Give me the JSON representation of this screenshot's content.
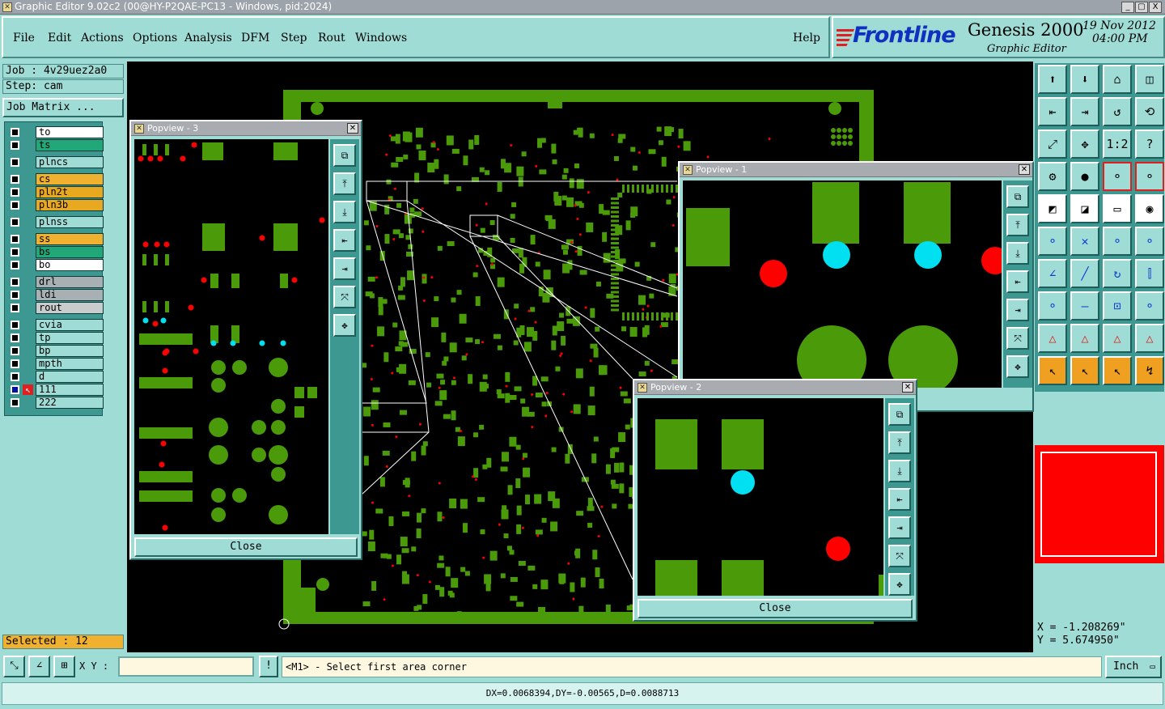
{
  "window": {
    "title": "Graphic Editor 9.02c2 (00@HY-P2QAE-PC13 - Windows, pid:2024)",
    "buttons": [
      "_",
      "▢",
      "X"
    ]
  },
  "menu": {
    "items": [
      "File",
      "Edit",
      "Actions",
      "Options",
      "Analysis",
      "DFM",
      "Step",
      "Rout",
      "Windows"
    ],
    "help": "Help"
  },
  "brand": {
    "logo": "Frontline",
    "product": "Genesis 2000",
    "subtitle": "Graphic Editor",
    "date": "19 Nov 2012",
    "time": "04:00 PM"
  },
  "job": {
    "job_label": "Job : 4v29uez2a0",
    "step_label": "Step: cam",
    "matrix_button": "Job Matrix ..."
  },
  "layers": [
    {
      "name": "to",
      "color": "#ffffff"
    },
    {
      "name": "ts",
      "color": "#22a878"
    },
    {
      "name": "plncs",
      "color": "#9fdcd6"
    },
    {
      "name": "cs",
      "color": "#f0b030"
    },
    {
      "name": "pln2t",
      "color": "#e8a820"
    },
    {
      "name": "pln3b",
      "color": "#e8a820"
    },
    {
      "name": "plnss",
      "color": "#9fdcd6"
    },
    {
      "name": "ss",
      "color": "#f0b030"
    },
    {
      "name": "bs",
      "color": "#22a878"
    },
    {
      "name": "bo",
      "color": "#ffffff"
    },
    {
      "name": "drl",
      "color": "#a8b0b4"
    },
    {
      "name": "ldi",
      "color": "#a8b0b4"
    },
    {
      "name": "rout",
      "color": "#c8cccc"
    },
    {
      "name": "cvia",
      "color": "#9fdcd6"
    },
    {
      "name": "tp",
      "color": "#9fdcd6"
    },
    {
      "name": "bp",
      "color": "#9fdcd6"
    },
    {
      "name": "mpth",
      "color": "#9fdcd6"
    },
    {
      "name": "d",
      "color": "#9fdcd6"
    },
    {
      "name": "111",
      "color": "#9fdcd6"
    },
    {
      "name": "222",
      "color": "#9fdcd6"
    }
  ],
  "selected": "Selected : 12",
  "popviews": {
    "p1": {
      "title": "Popview - 1"
    },
    "p2": {
      "title": "Popview - 2",
      "close": "Close"
    },
    "p3": {
      "title": "Popview - 3",
      "close": "Close"
    }
  },
  "coords": {
    "x": "X = -1.208269\"",
    "y": "Y = 5.674950\""
  },
  "bottom": {
    "xy_label": "X Y :",
    "xy_value": "",
    "info_button": "!",
    "prompt": "<M1> - Select first area corner",
    "units": "Inch"
  },
  "status": "DX=0.0068394,DY=-0.00565,D=0.0088713",
  "colors": {
    "copper": "#4a9a0a",
    "pad_red": "#ff0000",
    "pad_cyan": "#00e0f0",
    "teal": "#9fdcd6",
    "dark_teal": "#3d9892"
  }
}
